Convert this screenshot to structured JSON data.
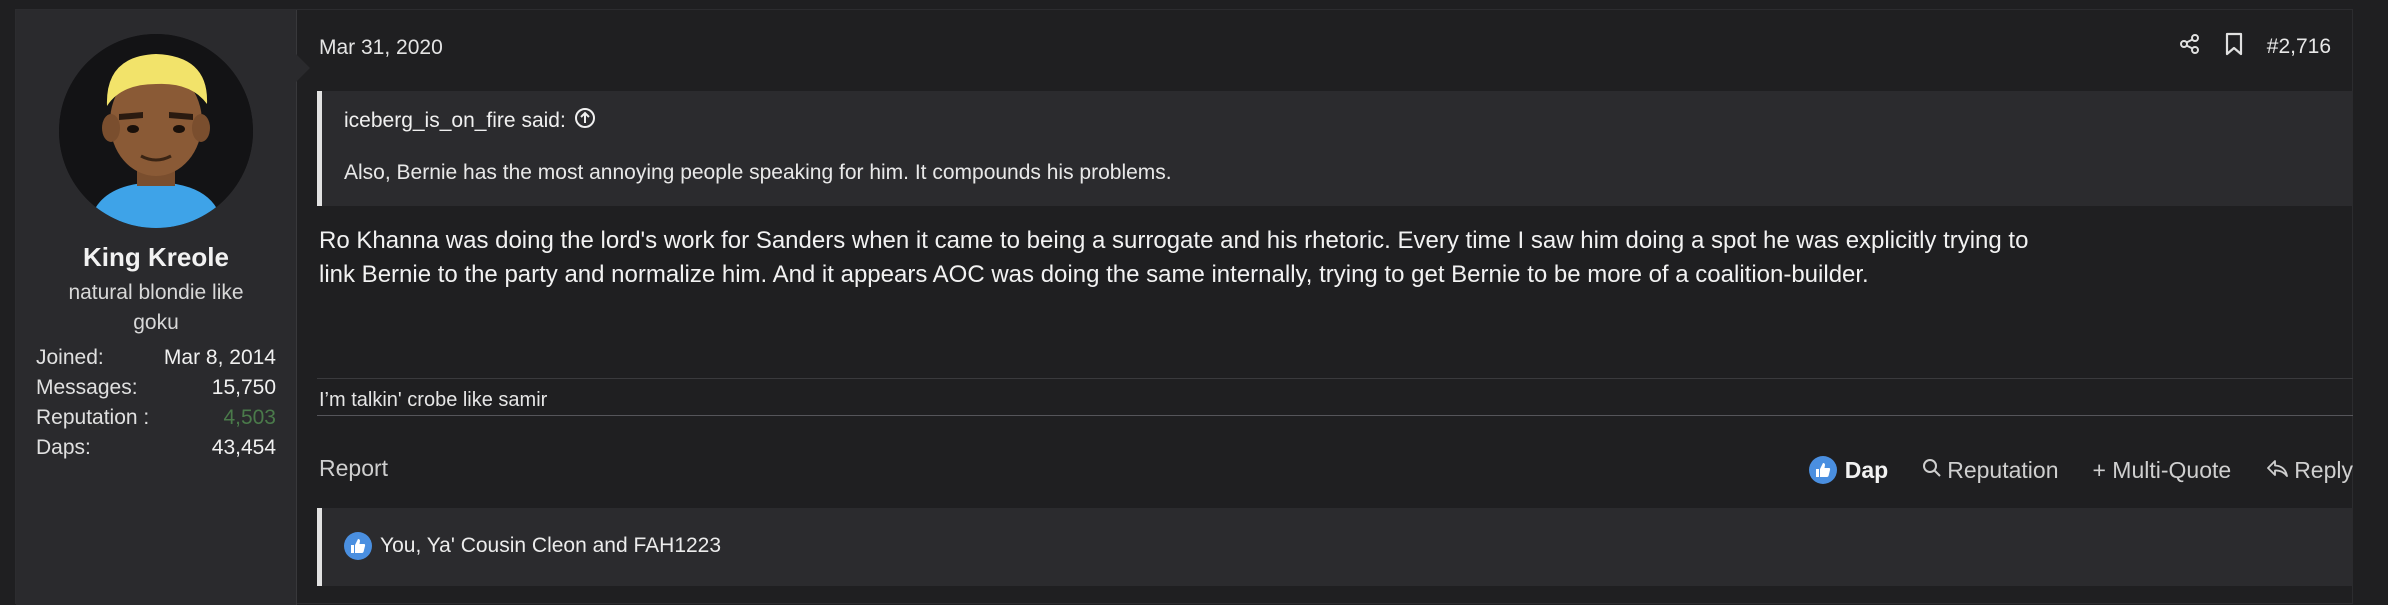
{
  "user": {
    "name": "King Kreole",
    "title": "natural blondie like goku",
    "stats": [
      {
        "label": "Joined:",
        "value": "Mar 8, 2014"
      },
      {
        "label": "Messages:",
        "value": "15,750"
      },
      {
        "label": "Reputation :",
        "value": "4,503"
      },
      {
        "label": "Daps:",
        "value": "43,454"
      }
    ]
  },
  "post": {
    "date": "Mar 31, 2020",
    "number": "#2,716",
    "quote": {
      "author_said": "iceberg_is_on_fire said:",
      "text": "Also, Bernie has the most annoying people speaking for him. It compounds his problems."
    },
    "message_lines": [
      "Ro Khanna was doing the lord's work for Sanders when it came to being a surrogate and his rhetoric. Every time I saw him doing a spot he was explicitly trying to",
      "link Bernie to the party and normalize him. And it appears AOC was doing the same internally, trying to get Bernie to be more of a coalition-builder."
    ],
    "signature": "I’m talkin' crobe like samir"
  },
  "actions": {
    "report": "Report",
    "dap": "Dap",
    "reputation": "Reputation",
    "multi_quote": "+ Multi-Quote",
    "reply": "Reply"
  },
  "reactions": {
    "text": "You, Ya' Cousin Cleon and FAH1223"
  },
  "colors": {
    "accent": "#4a8fe0",
    "reputation_value": "#4a7a4a"
  }
}
